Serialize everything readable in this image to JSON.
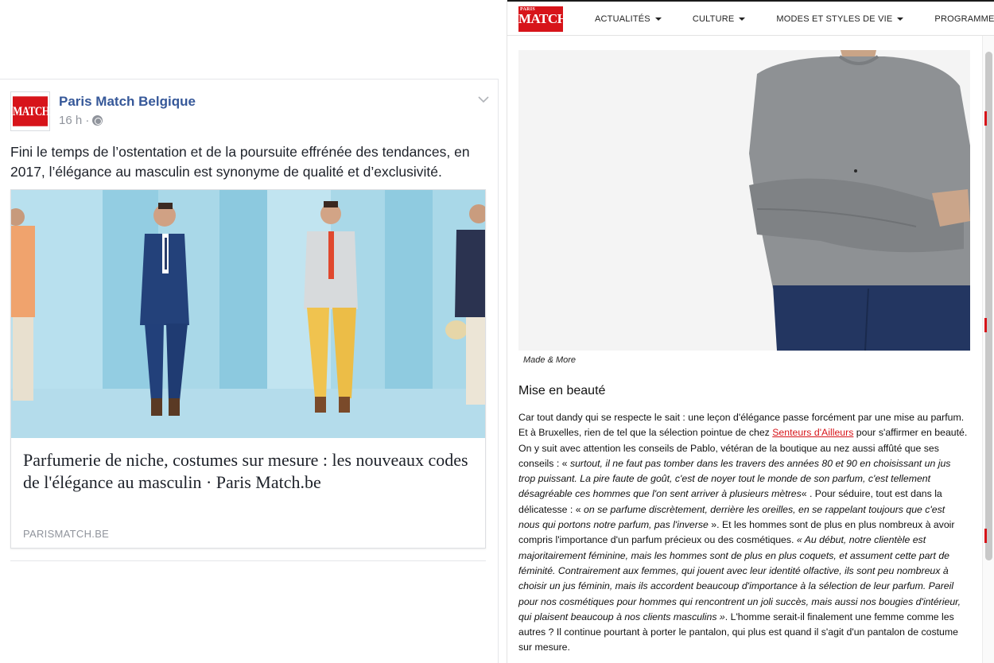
{
  "facebook": {
    "page_name": "Paris Match Belgique",
    "time": "16 h ·",
    "icons": {
      "avatar": "paris-match-logo",
      "privacy": "globe-icon",
      "options": "chevron-down-icon"
    },
    "post_text": "Fini le temps de l’ostentation et de la poursuite effrénée des tendances, en 2017, l’élégance au masculin est synonyme de qualité et d’exclusivité.",
    "card": {
      "title": "Parfumerie de niche, costumes sur mesure : les nouveaux codes de l'élégance au masculin · Paris Match.be",
      "domain": "PARISMATCH.BE"
    }
  },
  "parismatch": {
    "logo_text": "MATCH",
    "logo_small": "PARIS",
    "menu": [
      {
        "label": "ACTUALITÉS"
      },
      {
        "label": "CULTURE"
      },
      {
        "label": "MODES ET STYLES DE VIE"
      },
      {
        "label": "PROGRAMMES TÉLÉ"
      }
    ],
    "photo_caption": "Made & More",
    "heading": "Mise en beauté",
    "body": {
      "p1": "Car tout dandy qui se respecte le sait : une leçon d'élégance passe forcément par une mise au parfum. Et à Bruxelles, rien de tel que la sélection pointue de chez ",
      "link": "Senteurs d'Ailleurs",
      "p2": " pour s'affirmer en beauté.  On y suit avec attention les conseils de Pablo, vétéran de la boutique au nez aussi affûté que ses conseils : « ",
      "q1": "surtout, il ne faut pas tomber dans les travers des années 80 et 90 en choisissant un jus trop puissant. La pire faute de goût, c'est de noyer tout le monde de son parfum, c'est tellement désagréable ces hommes que l'on sent arriver à plusieurs mètres",
      "p3": "« . Pour séduire, tout est dans la délicatesse : « ",
      "q2": "on se parfume discrètement, derrière les oreilles, en se rappelant toujours que c'est nous qui portons notre parfum, pas l'inverse",
      "p4": " ». Et les hommes sont de plus en plus nombreux à avoir compris l'importance d'un parfum précieux ou des cosmétiques.",
      "q3": "« Au début, notre clientèle est majoritairement féminine, mais les hommes sont de plus en plus coquets, et assument cette part de féminité. Contrairement aux femmes, qui jouent avec leur identité olfactive, ils sont peu nombreux à choisir un jus féminin, mais ils accordent beaucoup d'importance à la sélection de leur parfum. Pareil pour nos cosmétiques pour hommes qui rencontrent un joli succès, mais aussi nos bougies d'intérieur, qui plaisent beaucoup à nos clients masculins »",
      "p5": ". L'homme serait-il finalement une femme comme les autres ? Il continue pourtant à porter le pantalon, qui plus est quand il s'agit d'un pantalon de costume sur mesure."
    },
    "colors": {
      "brand_red": "#d7141a",
      "fb_link_blue": "#365899"
    }
  }
}
